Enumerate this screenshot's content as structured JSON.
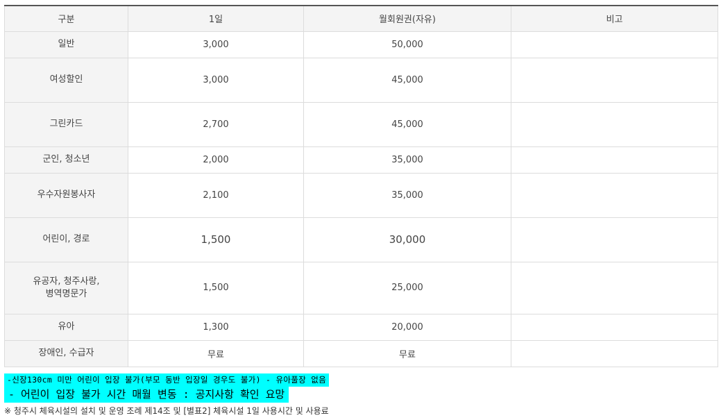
{
  "table": {
    "headers": [
      "구분",
      "1일",
      "월회원권(자유)",
      "비고"
    ],
    "rows": [
      {
        "category": "일반",
        "day": "3,000",
        "monthly": "50,000",
        "note": ""
      },
      {
        "category": "여성할인",
        "day": "3,000",
        "monthly": "45,000",
        "note": ""
      },
      {
        "category": "그린카드",
        "day": "2,700",
        "monthly": "45,000",
        "note": ""
      },
      {
        "category": "군인, 청소년",
        "day": "2,000",
        "monthly": "35,000",
        "note": ""
      },
      {
        "category": "우수자원봉사자",
        "day": "2,100",
        "monthly": "35,000",
        "note": ""
      },
      {
        "category": "어린이, 경로",
        "day": "1,500",
        "monthly": "30,000",
        "note": ""
      },
      {
        "category_line1": "유공자, 청주사랑,",
        "category_line2": "병역명문가",
        "day": "1,500",
        "monthly": "25,000",
        "note": ""
      },
      {
        "category": "유아",
        "day": "1,300",
        "monthly": "20,000",
        "note": ""
      },
      {
        "category": "장애인, 수급자",
        "day": "무료",
        "monthly": "무료",
        "note": ""
      }
    ]
  },
  "notes": {
    "highlight_1": "-신장130cm 미만 어린이 입장 불가(부모 동반 입장일 경우도 불가) - 유아풀장 없음",
    "highlight_2": "- 어린이 입장 불가 시간 매월 변동 : 공지사항 확인 요망",
    "footnote": "※ 청주시 체육시설의 설치 및 운영 조례 제14조 및 [별표2] 체육시설 1일 사용시간 및 사용료"
  },
  "colors": {
    "highlight": "#00ffff",
    "header_bg": "#f4f4f4",
    "border": "#dcdcdc"
  }
}
